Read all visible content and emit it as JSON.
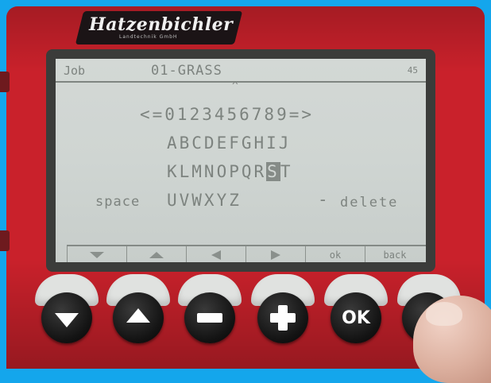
{
  "device": {
    "brand": "Hatzenbichler",
    "brand_subtitle": "Landtechnik GmbH"
  },
  "screen": {
    "status": {
      "left_label": "Job",
      "job_name": "01-GRASS",
      "right_number": "45"
    },
    "caret": "^",
    "keyboard": {
      "row1": "<=0123456789=>",
      "row2": "ABCDEFGHIJ",
      "row3_before": "KLMNOPQR",
      "row3_cursor": "S",
      "row3_after": "T",
      "row4": "UVWXYZ",
      "space_label": "space",
      "dash_label": "-",
      "delete_label": "delete"
    },
    "softkeys": [
      {
        "icon": "arrow-down-icon",
        "label": ""
      },
      {
        "icon": "arrow-up-icon",
        "label": ""
      },
      {
        "icon": "arrow-left-icon",
        "label": ""
      },
      {
        "icon": "arrow-right-icon",
        "label": ""
      },
      {
        "icon": "",
        "label": "ok"
      },
      {
        "icon": "",
        "label": "back"
      }
    ]
  },
  "hardware_buttons": [
    {
      "icon": "down-arrow-icon"
    },
    {
      "icon": "up-arrow-icon"
    },
    {
      "icon": "minus-icon"
    },
    {
      "icon": "plus-icon"
    },
    {
      "label": "OK"
    },
    {
      "icon": "blank"
    }
  ],
  "colors": {
    "background": "#14a6ec",
    "housing": "#c9212b",
    "lcd": "#d3d8d5",
    "lcd_text": "#7d837f",
    "button": "#141414"
  }
}
